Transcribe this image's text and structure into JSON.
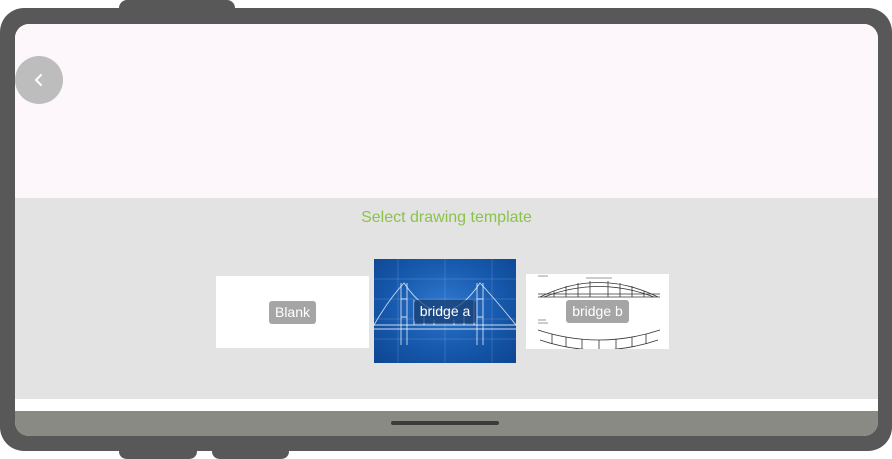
{
  "back_button": {
    "icon": "chevron-left-icon"
  },
  "template_panel": {
    "title": "Select drawing template",
    "title_color": "#8bc34a",
    "templates": [
      {
        "label": "Blank"
      },
      {
        "label": "bridge a"
      },
      {
        "label": "bridge b"
      }
    ]
  },
  "colors": {
    "frame": "#585858",
    "screen_background": "#fdf7fb",
    "panel_background": "#e3e3e3",
    "back_button": "#bdbdbd",
    "blueprint": "#1659ad",
    "nav_bar": "#8a8a84"
  }
}
